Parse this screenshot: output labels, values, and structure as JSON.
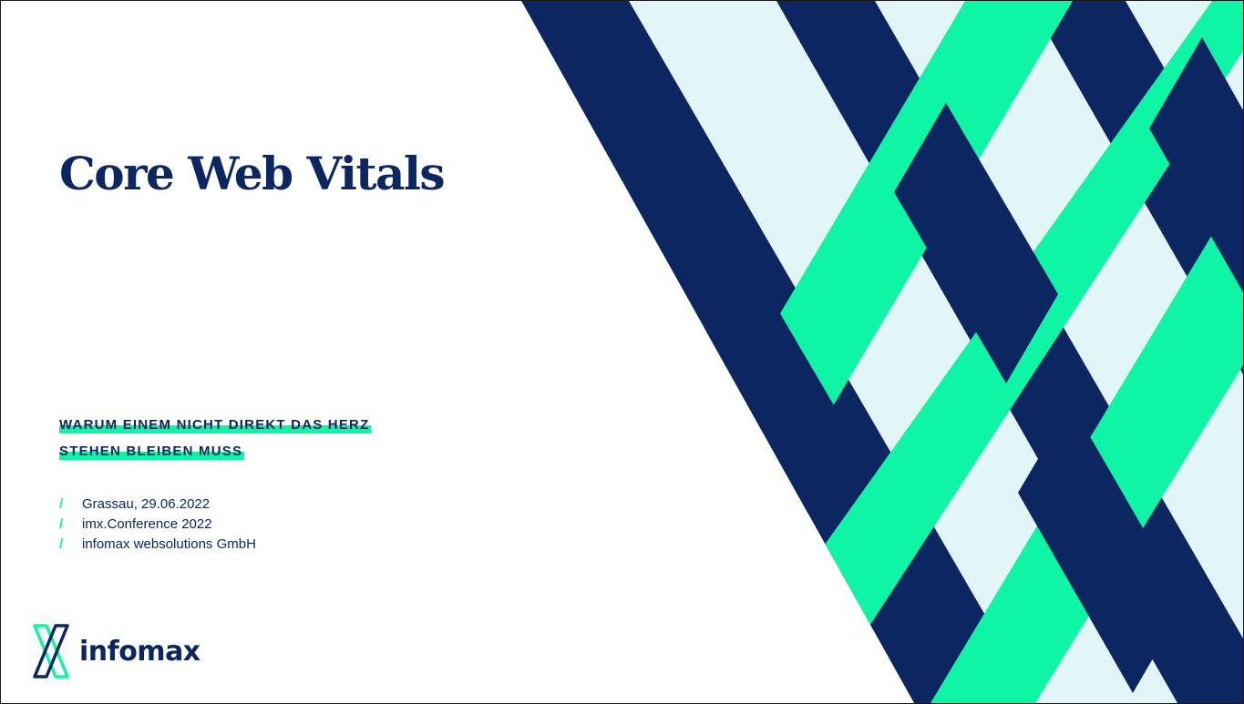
{
  "slide": {
    "title": "Core Web Vitals",
    "subtitle_lines": [
      "WARUM EINEM NICHT DIREKT DAS HERZ",
      "STEHEN BLEIBEN MUSS"
    ],
    "meta": [
      "Grassau, 29.06.2022",
      "imx.Conference 2022",
      "infomax websolutions GmbH"
    ],
    "bullet_glyph": "/",
    "logo": {
      "text": "infomax",
      "icon": "infomax-logo-icon"
    }
  },
  "colors": {
    "navy": "#0b2661",
    "green": "#0df5a5",
    "light": "#e2f6f7",
    "background": "#ffffff"
  }
}
